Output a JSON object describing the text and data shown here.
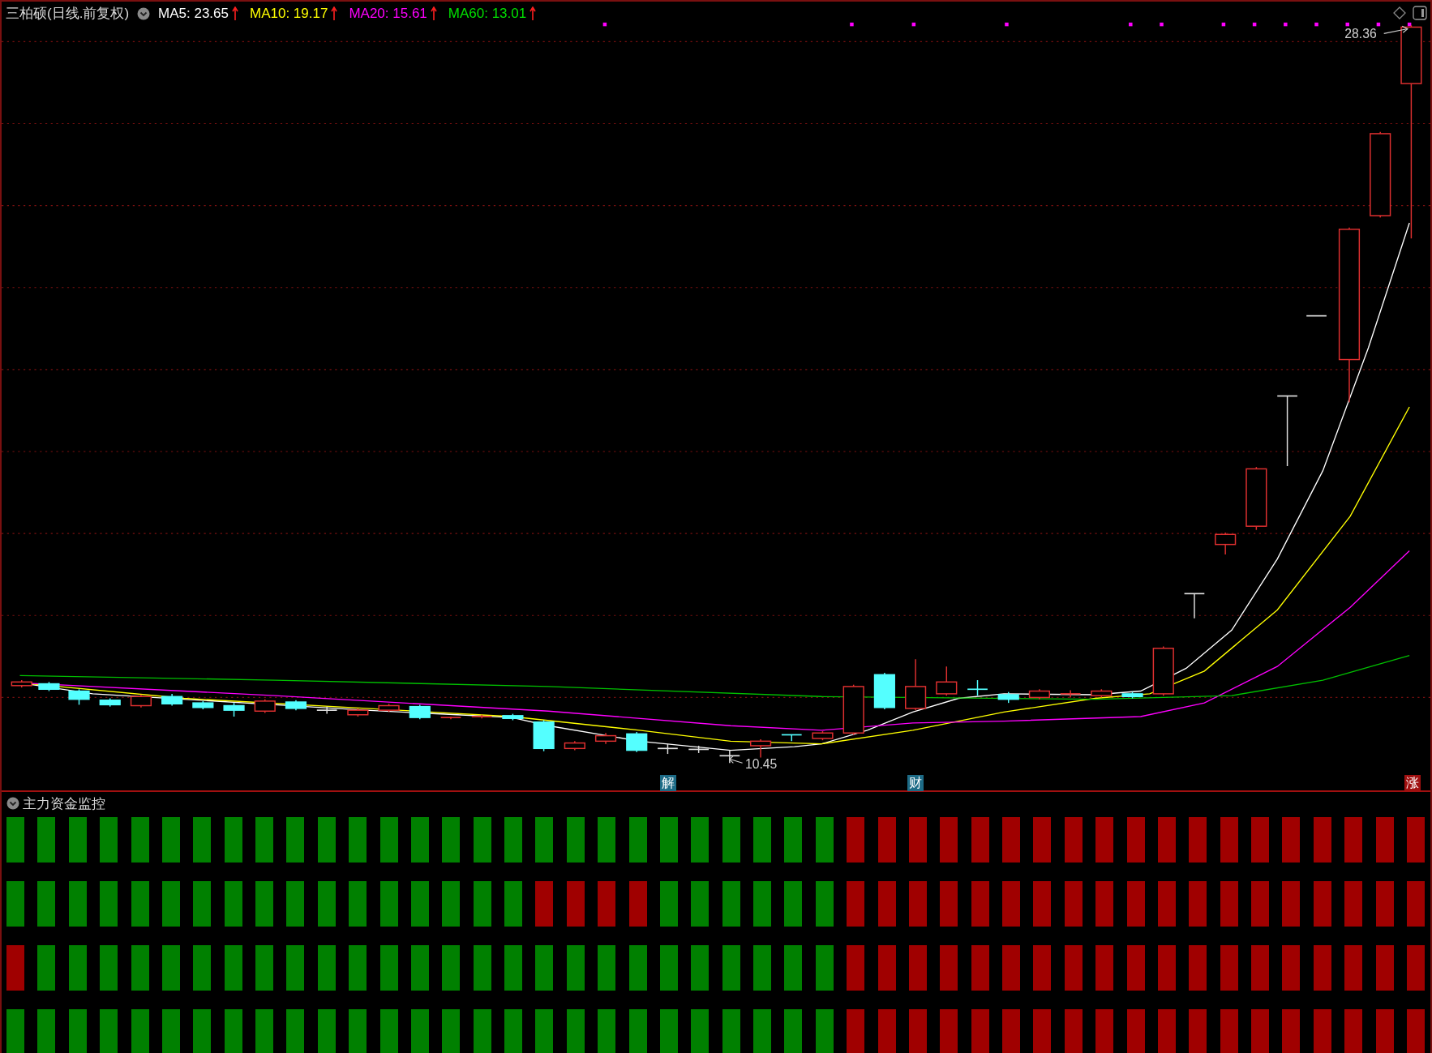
{
  "header": {
    "stock": "三柏硕(日线.前复权)"
  },
  "indicators": [
    {
      "label": "MA5: 23.65",
      "color": "#ffffff"
    },
    {
      "label": "MA10: 19.17",
      "color": "#ffff00"
    },
    {
      "label": "MA20: 15.61",
      "color": "#ff00ff"
    },
    {
      "label": "MA60: 13.01",
      "color": "#00e000"
    }
  ],
  "price_labels": {
    "high": "28.36",
    "low": "10.45"
  },
  "event_markers": [
    {
      "label": "解",
      "color": "#1d6b86"
    },
    {
      "label": "财",
      "color": "#1d6b86"
    },
    {
      "label": "涨",
      "color": "#a01010"
    }
  ],
  "panel": {
    "title": "主力资金监控",
    "rows": [
      {
        "cells": [
          {
            "color": "#008000"
          },
          {
            "color": "#008000"
          },
          {
            "color": "#008000"
          },
          {
            "color": "#008000"
          },
          {
            "color": "#008000"
          },
          {
            "color": "#008000"
          },
          {
            "color": "#008000"
          },
          {
            "color": "#008000"
          },
          {
            "color": "#008000"
          },
          {
            "color": "#008000"
          },
          {
            "color": "#008000"
          },
          {
            "color": "#008000"
          },
          {
            "color": "#008000"
          },
          {
            "color": "#008000"
          },
          {
            "color": "#008000"
          },
          {
            "color": "#008000"
          },
          {
            "color": "#008000"
          },
          {
            "color": "#008000"
          },
          {
            "color": "#008000"
          },
          {
            "color": "#008000"
          },
          {
            "color": "#008000"
          },
          {
            "color": "#008000"
          },
          {
            "color": "#008000"
          },
          {
            "color": "#008000"
          },
          {
            "color": "#008000"
          },
          {
            "color": "#008000"
          },
          {
            "color": "#008000"
          },
          {
            "color": "#a00000"
          },
          {
            "color": "#a00000"
          },
          {
            "color": "#a00000"
          },
          {
            "color": "#a00000"
          },
          {
            "color": "#a00000"
          },
          {
            "color": "#a00000"
          },
          {
            "color": "#a00000"
          },
          {
            "color": "#a00000"
          },
          {
            "color": "#a00000"
          },
          {
            "color": "#a00000"
          },
          {
            "color": "#a00000"
          },
          {
            "color": "#a00000"
          },
          {
            "color": "#a00000"
          },
          {
            "color": "#a00000"
          },
          {
            "color": "#a00000"
          },
          {
            "color": "#a00000"
          },
          {
            "color": "#a00000"
          },
          {
            "color": "#a00000"
          },
          {
            "color": "#a00000"
          }
        ]
      },
      {
        "cells": [
          {
            "color": "#008000"
          },
          {
            "color": "#008000"
          },
          {
            "color": "#008000"
          },
          {
            "color": "#008000"
          },
          {
            "color": "#008000"
          },
          {
            "color": "#008000"
          },
          {
            "color": "#008000"
          },
          {
            "color": "#008000"
          },
          {
            "color": "#008000"
          },
          {
            "color": "#008000"
          },
          {
            "color": "#008000"
          },
          {
            "color": "#008000"
          },
          {
            "color": "#008000"
          },
          {
            "color": "#008000"
          },
          {
            "color": "#008000"
          },
          {
            "color": "#008000"
          },
          {
            "color": "#008000"
          },
          {
            "color": "#a00000"
          },
          {
            "color": "#a00000"
          },
          {
            "color": "#a00000"
          },
          {
            "color": "#a00000"
          },
          {
            "color": "#008000"
          },
          {
            "color": "#008000"
          },
          {
            "color": "#008000"
          },
          {
            "color": "#008000"
          },
          {
            "color": "#008000"
          },
          {
            "color": "#008000"
          },
          {
            "color": "#a00000"
          },
          {
            "color": "#a00000"
          },
          {
            "color": "#a00000"
          },
          {
            "color": "#a00000"
          },
          {
            "color": "#a00000"
          },
          {
            "color": "#a00000"
          },
          {
            "color": "#a00000"
          },
          {
            "color": "#a00000"
          },
          {
            "color": "#a00000"
          },
          {
            "color": "#a00000"
          },
          {
            "color": "#a00000"
          },
          {
            "color": "#a00000"
          },
          {
            "color": "#a00000"
          },
          {
            "color": "#a00000"
          },
          {
            "color": "#a00000"
          },
          {
            "color": "#a00000"
          },
          {
            "color": "#a00000"
          },
          {
            "color": "#a00000"
          },
          {
            "color": "#a00000"
          }
        ]
      },
      {
        "cells": [
          {
            "color": "#a00000"
          },
          {
            "color": "#008000"
          },
          {
            "color": "#008000"
          },
          {
            "color": "#008000"
          },
          {
            "color": "#008000"
          },
          {
            "color": "#008000"
          },
          {
            "color": "#008000"
          },
          {
            "color": "#008000"
          },
          {
            "color": "#008000"
          },
          {
            "color": "#008000"
          },
          {
            "color": "#008000"
          },
          {
            "color": "#008000"
          },
          {
            "color": "#008000"
          },
          {
            "color": "#008000"
          },
          {
            "color": "#008000"
          },
          {
            "color": "#008000"
          },
          {
            "color": "#008000"
          },
          {
            "color": "#008000"
          },
          {
            "color": "#008000"
          },
          {
            "color": "#008000"
          },
          {
            "color": "#008000"
          },
          {
            "color": "#008000"
          },
          {
            "color": "#008000"
          },
          {
            "color": "#008000"
          },
          {
            "color": "#008000"
          },
          {
            "color": "#008000"
          },
          {
            "color": "#008000"
          },
          {
            "color": "#a00000"
          },
          {
            "color": "#a00000"
          },
          {
            "color": "#a00000"
          },
          {
            "color": "#a00000"
          },
          {
            "color": "#a00000"
          },
          {
            "color": "#a00000"
          },
          {
            "color": "#a00000"
          },
          {
            "color": "#a00000"
          },
          {
            "color": "#a00000"
          },
          {
            "color": "#a00000"
          },
          {
            "color": "#a00000"
          },
          {
            "color": "#a00000"
          },
          {
            "color": "#a00000"
          },
          {
            "color": "#a00000"
          },
          {
            "color": "#a00000"
          },
          {
            "color": "#a00000"
          },
          {
            "color": "#a00000"
          },
          {
            "color": "#a00000"
          },
          {
            "color": "#a00000"
          }
        ]
      },
      {
        "cells": [
          {
            "color": "#008000"
          },
          {
            "color": "#008000"
          },
          {
            "color": "#008000"
          },
          {
            "color": "#008000"
          },
          {
            "color": "#008000"
          },
          {
            "color": "#008000"
          },
          {
            "color": "#008000"
          },
          {
            "color": "#008000"
          },
          {
            "color": "#008000"
          },
          {
            "color": "#008000"
          },
          {
            "color": "#008000"
          },
          {
            "color": "#008000"
          },
          {
            "color": "#008000"
          },
          {
            "color": "#008000"
          },
          {
            "color": "#008000"
          },
          {
            "color": "#008000"
          },
          {
            "color": "#008000"
          },
          {
            "color": "#008000"
          },
          {
            "color": "#008000"
          },
          {
            "color": "#008000"
          },
          {
            "color": "#008000"
          },
          {
            "color": "#008000"
          },
          {
            "color": "#008000"
          },
          {
            "color": "#008000"
          },
          {
            "color": "#008000"
          },
          {
            "color": "#008000"
          },
          {
            "color": "#008000"
          },
          {
            "color": "#a00000"
          },
          {
            "color": "#a00000"
          },
          {
            "color": "#a00000"
          },
          {
            "color": "#a00000"
          },
          {
            "color": "#a00000"
          },
          {
            "color": "#a00000"
          },
          {
            "color": "#a00000"
          },
          {
            "color": "#a00000"
          },
          {
            "color": "#a00000"
          },
          {
            "color": "#a00000"
          },
          {
            "color": "#a00000"
          },
          {
            "color": "#a00000"
          },
          {
            "color": "#a00000"
          },
          {
            "color": "#a00000"
          },
          {
            "color": "#a00000"
          },
          {
            "color": "#a00000"
          },
          {
            "color": "#a00000"
          },
          {
            "color": "#a00000"
          },
          {
            "color": "#a00000"
          }
        ]
      }
    ]
  }
}
